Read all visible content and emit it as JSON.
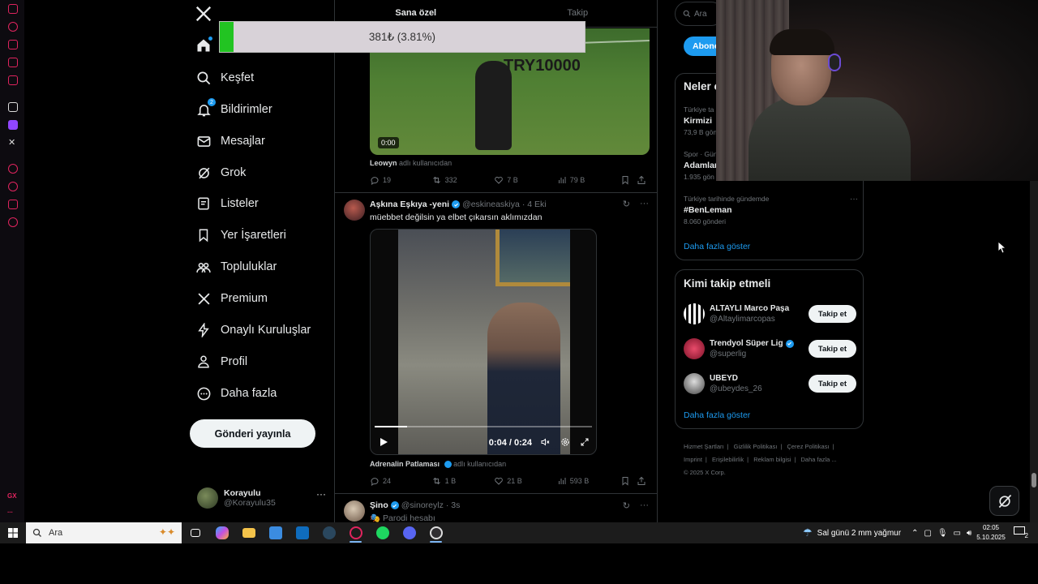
{
  "price_overlay": {
    "text": "381₺ (3.81%)",
    "progress_percent": 3.81
  },
  "nav": {
    "items": [
      {
        "label": "",
        "icon": "home-icon"
      },
      {
        "label": "Keşfet",
        "icon": "search-icon"
      },
      {
        "label": "Bildirimler",
        "icon": "bell-icon",
        "badge": "2"
      },
      {
        "label": "Mesajlar",
        "icon": "mail-icon"
      },
      {
        "label": "Grok",
        "icon": "grok-icon"
      },
      {
        "label": "Listeler",
        "icon": "list-icon"
      },
      {
        "label": "Yer İşaretleri",
        "icon": "bookmark-icon"
      },
      {
        "label": "Topluluklar",
        "icon": "communities-icon"
      },
      {
        "label": "Premium",
        "icon": "x-icon"
      },
      {
        "label": "Onaylı Kuruluşlar",
        "icon": "lightning-icon"
      },
      {
        "label": "Profil",
        "icon": "person-icon"
      },
      {
        "label": "Daha fazla",
        "icon": "more-circle-icon"
      }
    ],
    "post_button": "Gönderi yayınla",
    "profile": {
      "name": "Korayulu",
      "handle": "@Korayulu35"
    }
  },
  "timeline": {
    "tabs": [
      "Sana özel",
      "Takip"
    ],
    "post1": {
      "video_overlay_text": "TRY10000",
      "video_time": "0:00",
      "source_user": "Leowyn",
      "source_suffix": "adlı kullanıcıdan",
      "replies": "19",
      "reposts": "332",
      "likes": "7 B",
      "views": "79 B"
    },
    "post2": {
      "name": "Aşkına Eşkıya -yeni",
      "handle": "@eskineaskiya",
      "date": "· 4 Eki",
      "text": "müebbet değilsin ya elbet çıkarsın aklımızdan",
      "video_time": "0:04 / 0:24",
      "video_progress": 0.15,
      "source_user": "Adrenalin Patlaması",
      "source_suffix": "adlı kullanıcıdan",
      "replies": "24",
      "reposts": "1 B",
      "likes": "21 B",
      "views": "593 B"
    },
    "post3": {
      "name": "Şino",
      "handle": "@sinoreylz",
      "date": "· 3s",
      "text": "🎭 Parodi hesabı"
    }
  },
  "right": {
    "search_placeholder": "Ara",
    "subscribe_label": "Abone ol",
    "trends": {
      "title": "Neler oluyor",
      "items": [
        {
          "context": "Türkiye ta",
          "name": "Kirmizi",
          "count": "73,9 B gön"
        },
        {
          "context": "Spor · Gün",
          "name": "Adamlar",
          "count": "1.935 gön"
        },
        {
          "context": "Türkiye tarihinde gündemde",
          "name": "#BenLeman",
          "count": "8.060 gönderi"
        }
      ],
      "show_more": "Daha fazla göster"
    },
    "who_to_follow": {
      "title": "Kimi takip etmeli",
      "items": [
        {
          "name": "ALTAYLI Marco Paşa",
          "handle": "@Altaylimarcopas",
          "verified": false,
          "button": "Takip et"
        },
        {
          "name": "Trendyol Süper Lig",
          "handle": "@superlig",
          "verified": true,
          "button": "Takip et"
        },
        {
          "name": "UBEYD",
          "handle": "@ubeydes_26",
          "verified": false,
          "button": "Takip et"
        }
      ],
      "show_more": "Daha fazla göster"
    },
    "footer": {
      "links": [
        "Hizmet Şartları",
        "|",
        "Gizlilik Politikası",
        "|",
        "Çerez Politikası",
        "|",
        "Imprint",
        "|",
        "Erişilebilirlik",
        "|",
        "Reklam bilgisi",
        "|",
        "Daha fazla ...",
        "© 2025 X Corp."
      ]
    }
  },
  "taskbar": {
    "search_label": "Ara",
    "weather": "Sal günü 2 mm yağmur",
    "time": "02:05",
    "date": "5.10.2025",
    "notifications": "2"
  },
  "gx_sidebar": {
    "label_gx": "GX",
    "label_more": "..."
  },
  "colors": {
    "accent": "#1d9bf0",
    "price_bar": "#22c422",
    "gx_red": "#e0245e"
  }
}
